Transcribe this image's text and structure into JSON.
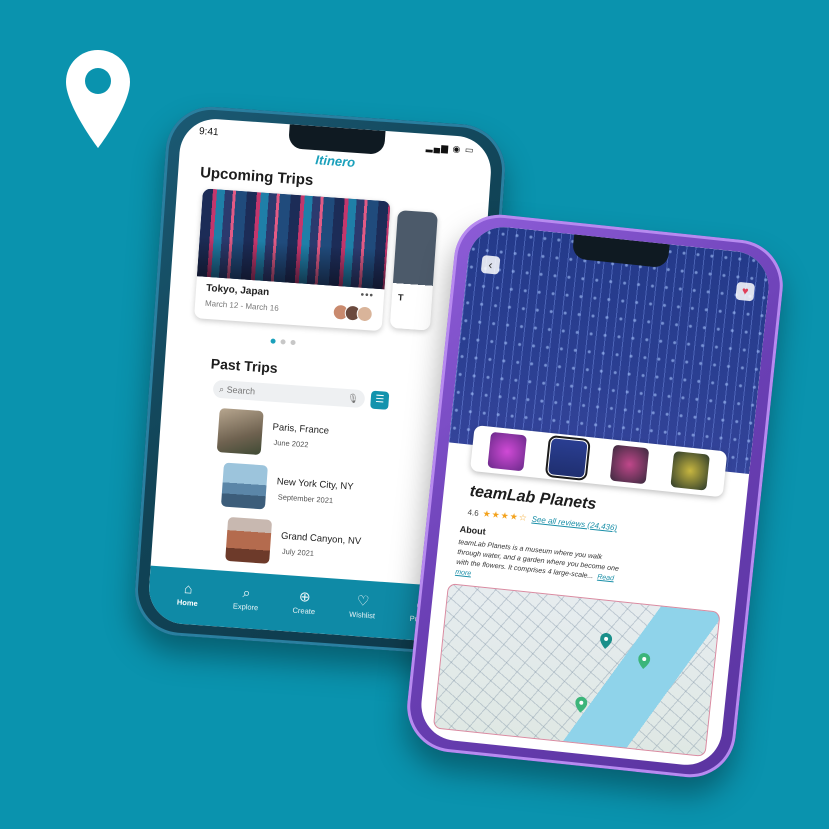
{
  "colors": {
    "background": "#0a93ae",
    "accent": "#1aa0bb",
    "tabbar": "#0f8aa6",
    "star": "#f3a21c"
  },
  "decor": {
    "pin_icon": "location-pin-icon"
  },
  "phone1": {
    "status": {
      "time": "9:41",
      "system": "▂▄▆ ◉ ▭"
    },
    "brand": "Itinero",
    "upcoming": {
      "heading": "Upcoming Trips",
      "card": {
        "title": "Tokyo, Japan",
        "dates": "March 12 - March 16",
        "more": "•••"
      },
      "peek_title": "T"
    },
    "past": {
      "heading": "Past Trips",
      "search_placeholder": "Search",
      "items": [
        {
          "name": "Paris, France",
          "date": "June 2022"
        },
        {
          "name": "New York City, NY",
          "date": "September 2021"
        },
        {
          "name": "Grand Canyon, NV",
          "date": "July 2021"
        }
      ]
    },
    "tabs": [
      {
        "label": "Home",
        "icon": "home-icon",
        "glyph": "⌂"
      },
      {
        "label": "Explore",
        "icon": "search-icon",
        "glyph": "⌕"
      },
      {
        "label": "Create",
        "icon": "plus-circle-icon",
        "glyph": "⊕"
      },
      {
        "label": "Wishlist",
        "icon": "heart-icon",
        "glyph": "♡"
      },
      {
        "label": "Profile",
        "icon": "user-icon",
        "glyph": "☺"
      }
    ]
  },
  "phone2": {
    "back_glyph": "‹",
    "heart_glyph": "♥",
    "place": {
      "name": "teamLab Planets",
      "rating": "4.6",
      "stars": "★★★★☆",
      "reviews_link": "See all reviews (24,436)"
    },
    "about": {
      "heading": "About",
      "text": "teamLab Planets is a museum where you walk through water, and a garden where you become one with the flowers. It comprises 4 large-scale...",
      "read_more": "Read more"
    }
  }
}
